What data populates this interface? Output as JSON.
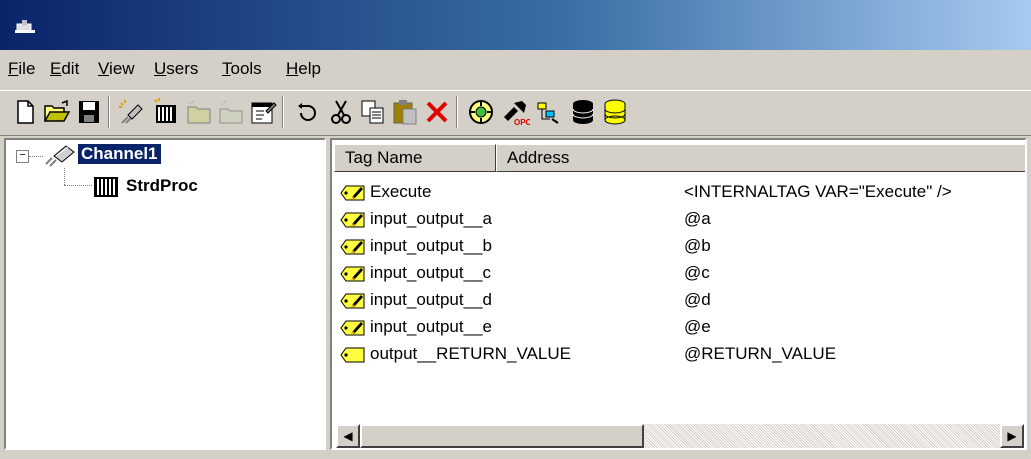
{
  "menu": {
    "file": {
      "mnemonic": "F",
      "rest": "ile"
    },
    "edit": {
      "mnemonic": "E",
      "rest": "dit"
    },
    "view": {
      "mnemonic": "V",
      "rest": "iew"
    },
    "users": {
      "mnemonic": "U",
      "rest": "sers"
    },
    "tools": {
      "mnemonic": "T",
      "rest": "ools"
    },
    "help": {
      "mnemonic": "H",
      "rest": "elp"
    }
  },
  "toolbar": {
    "icons": [
      "new-icon",
      "open-icon",
      "save-icon",
      "new-channel-icon",
      "new-device-icon",
      "new-group-icon",
      "new-tag-icon",
      "properties-icon",
      "undo-icon",
      "cut-icon",
      "copy-icon",
      "paste-icon",
      "delete-icon",
      "quick-client-icon",
      "opc-icon",
      "tag-browser-icon",
      "database-icon",
      "database-config-icon"
    ]
  },
  "tree": {
    "channel": {
      "label": "Channel1",
      "expanded": true,
      "selected": true
    },
    "device": {
      "label": "StrdProc"
    }
  },
  "table": {
    "columns": {
      "tag_name": "Tag Name",
      "address": "Address"
    },
    "rows": [
      {
        "name": "Execute",
        "address": "<INTERNALTAG VAR=\"Execute\" />",
        "icon": "read-write-tag-icon"
      },
      {
        "name": "input_output__a",
        "address": "@a",
        "icon": "read-write-tag-icon"
      },
      {
        "name": "input_output__b",
        "address": "@b",
        "icon": "read-write-tag-icon"
      },
      {
        "name": "input_output__c",
        "address": "@c",
        "icon": "read-write-tag-icon"
      },
      {
        "name": "input_output__d",
        "address": "@d",
        "icon": "read-write-tag-icon"
      },
      {
        "name": "input_output__e",
        "address": "@e",
        "icon": "read-write-tag-icon"
      },
      {
        "name": "output__RETURN_VALUE",
        "address": "@RETURN_VALUE",
        "icon": "read-only-tag-icon"
      }
    ]
  },
  "colors": {
    "title_start": "#0a246a",
    "title_end": "#a6caf0",
    "selection": "#0a246a",
    "face": "#d4d0c8"
  }
}
